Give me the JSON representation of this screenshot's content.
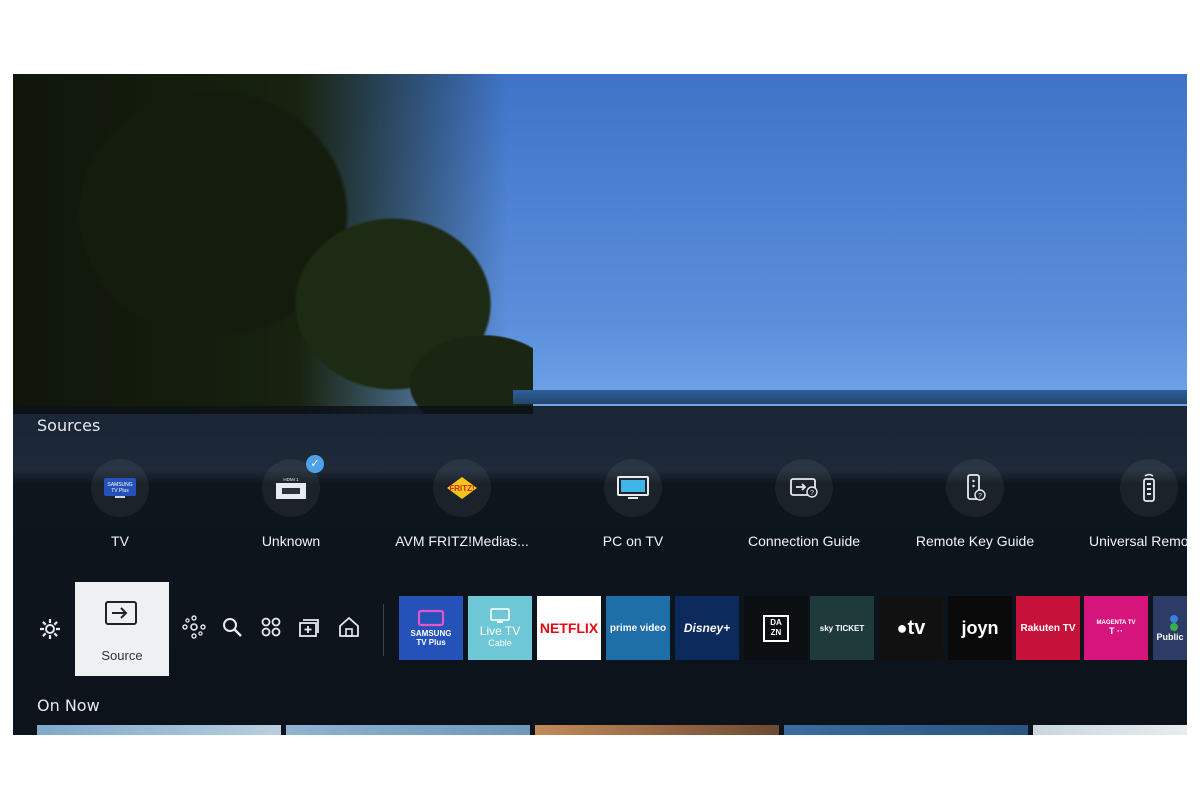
{
  "sources": {
    "title": "Sources",
    "items": [
      {
        "label": "TV",
        "icon": "samsung-tv-plus-icon",
        "badge": "SAMSUNG\nTV Plus"
      },
      {
        "label": "Unknown",
        "icon": "hdmi-icon",
        "badge": "HDMI 1",
        "selected": true
      },
      {
        "label": "AVM FRITZ!Medias...",
        "icon": "fritz-icon",
        "badge": "FRITZ!"
      },
      {
        "label": "PC on TV",
        "icon": "monitor-icon"
      },
      {
        "label": "Connection Guide",
        "icon": "connection-guide-icon"
      },
      {
        "label": "Remote Key Guide",
        "icon": "remote-key-guide-icon"
      },
      {
        "label": "Universal Remo",
        "icon": "remote-icon"
      }
    ]
  },
  "bar": {
    "settings_icon": "gear-icon",
    "source_label": "Source",
    "nav_icons": [
      "ambient-icon",
      "search-icon",
      "apps-icon",
      "media-icon",
      "home-icon"
    ],
    "apps": [
      {
        "name": "SAMSUNG\nTV Plus",
        "bg": "#2452b8",
        "fg": "#ffffff"
      },
      {
        "name": "Live TV",
        "sub": "Cable",
        "bg": "#6ec7d6",
        "fg": "#ffffff"
      },
      {
        "name": "NETFLIX",
        "bg": "#ffffff",
        "fg": "#e50914"
      },
      {
        "name": "prime video",
        "bg": "#1e6ea8",
        "fg": "#ffffff"
      },
      {
        "name": "Disney+",
        "bg": "#0d2a5c",
        "fg": "#ffffff"
      },
      {
        "name": "DA\nZN",
        "bg": "#0c0f12",
        "fg": "#ffffff"
      },
      {
        "name": "sky TICKET",
        "bg": "#1f3a3a",
        "fg": "#ffffff"
      },
      {
        "name": "tv",
        "bg": "#111111",
        "fg": "#ffffff"
      },
      {
        "name": "joyn",
        "bg": "#0a0a0a",
        "fg": "#ffffff"
      },
      {
        "name": "Rakuten TV",
        "bg": "#c6123a",
        "fg": "#ffffff"
      },
      {
        "name": "MAGENTA TV",
        "sub": "T ··",
        "bg": "#d6157c",
        "fg": "#ffffff"
      },
      {
        "name": "Public",
        "bg": "#2c3c66",
        "fg": "#ffffff"
      }
    ]
  },
  "on_now": {
    "title": "On Now"
  },
  "colors": {
    "overlay": "#0c1218",
    "highlight": "#eef0f2",
    "accent": "#4ea3e8"
  }
}
